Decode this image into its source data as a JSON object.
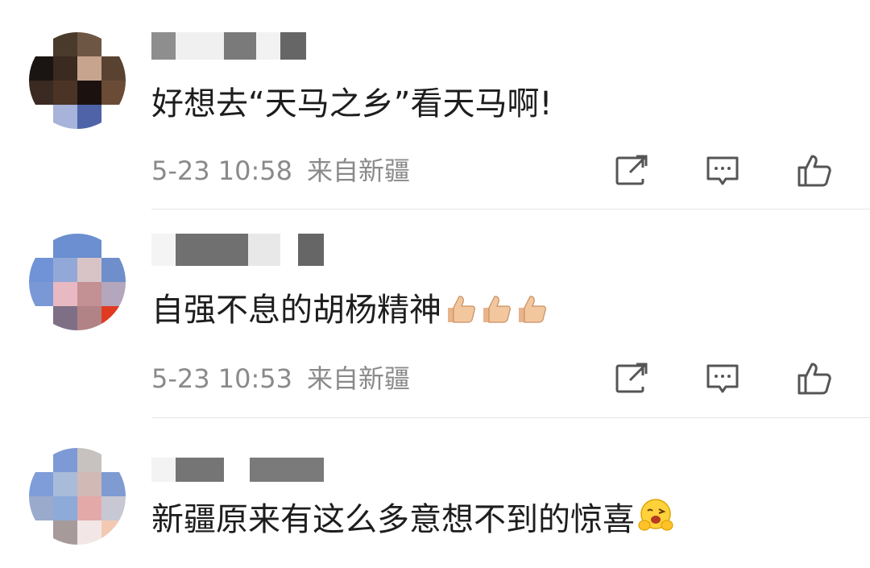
{
  "comments": [
    {
      "text": "好想去“天马之乡”看天马啊!",
      "time": "5-23 10:58",
      "source": "来自新疆"
    },
    {
      "text": "自强不息的胡杨精神",
      "emoji": [
        "thumbs-up",
        "thumbs-up",
        "thumbs-up"
      ],
      "time": "5-23 10:53",
      "source": "来自新疆"
    },
    {
      "text": "新疆原来有这么多意想不到的惊喜",
      "emoji": [
        "hug-face"
      ]
    }
  ],
  "icons": {
    "share": "share-icon",
    "comment": "comment-icon",
    "like": "like-icon"
  },
  "colors": {
    "text": "#1d1d1d",
    "meta": "#8a8a8a",
    "icon": "#555555",
    "divider": "#e6e6e6"
  }
}
